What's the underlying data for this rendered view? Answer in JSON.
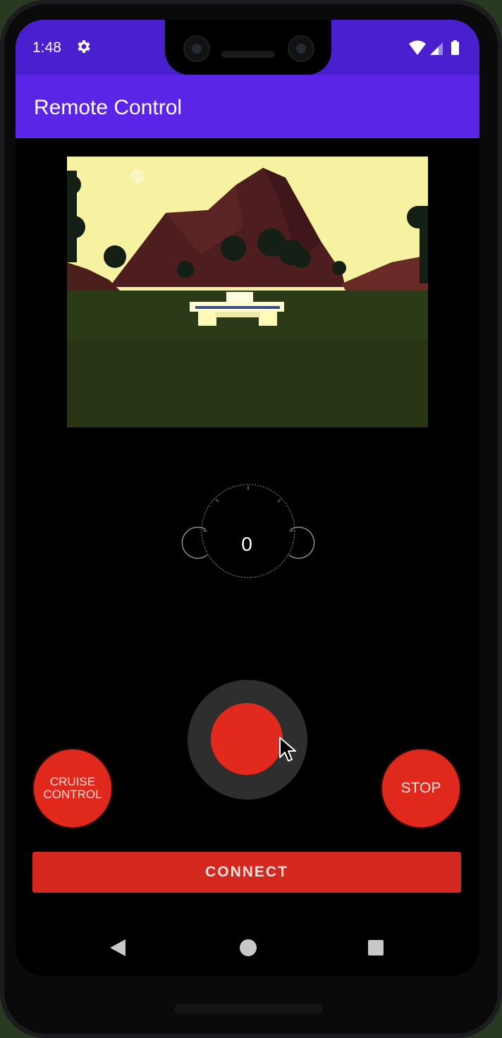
{
  "status_bar": {
    "time": "1:48",
    "icons": [
      "gear-icon",
      "wifi-icon",
      "cellular-icon",
      "battery-icon"
    ]
  },
  "app_bar": {
    "title": "Remote Control",
    "color": "#5b24e6"
  },
  "camera_feed": {
    "description_icon": "camera-feed"
  },
  "speed_gauge": {
    "value": "0"
  },
  "joystick": {
    "knob_color": "#e2291e"
  },
  "buttons": {
    "cruise_control_line1": "CRUISE",
    "cruise_control_line2": "CONTROL",
    "stop": "STOP",
    "connect": "CONNECT",
    "accent": "#e0281d"
  },
  "nav_bar": {
    "icons": [
      "back-icon",
      "home-icon",
      "recents-icon"
    ]
  }
}
